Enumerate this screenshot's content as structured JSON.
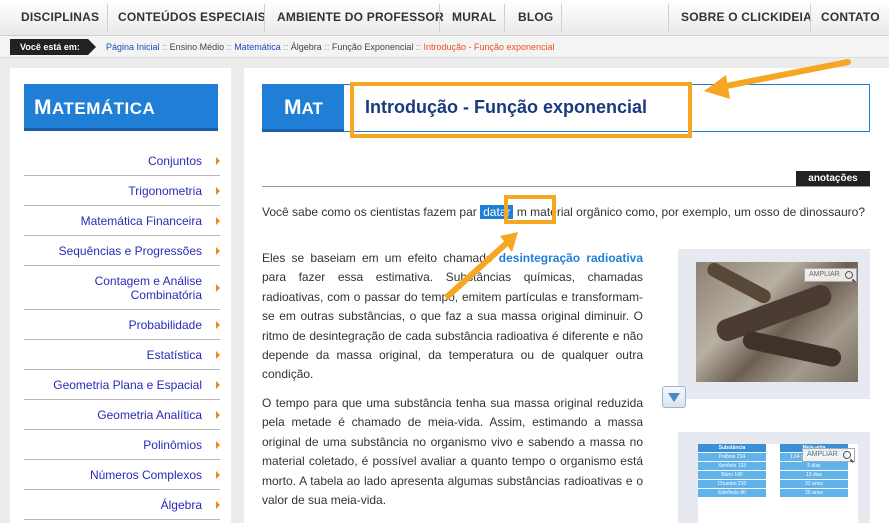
{
  "topnav": {
    "left": [
      "DISCIPLINAS",
      "CONTEÚDOS ESPECIAIS",
      "AMBIENTE DO PROFESSOR",
      "MURAL",
      "BLOG"
    ],
    "right": [
      "SOBRE O CLICKIDEIA",
      "CONTATO"
    ]
  },
  "breadcrumb": {
    "label": "Você está em:",
    "items": [
      "Página Inicial",
      "Ensino Médio",
      "Matemática",
      "Álgebra",
      "Função Exponencial"
    ],
    "separator": "::",
    "current": "Introdução - Função exponencial"
  },
  "sidebar": {
    "title_first": "M",
    "title_rest": "ATEMÁTICA",
    "items": [
      "Conjuntos",
      "Trigonometria",
      "Matemática Financeira",
      "Sequências e Progressões",
      "Contagem e Análise Combinatória",
      "Probabilidade",
      "Estatística",
      "Geometria Plana e Espacial",
      "Geometria Analítica",
      "Polinômios",
      "Números Complexos",
      "Álgebra"
    ]
  },
  "content": {
    "mat_first": "M",
    "mat_rest": "AT",
    "title": "Introdução - Função exponencial",
    "annotations_tab": "anotações",
    "p1_before": "Você sabe como os cientistas fazem par",
    "p1_word": "datar",
    "p1_after": "m material orgânico como, por exemplo, um osso de dinossauro?",
    "p2_before": "Eles se baseiam em um efeito ",
    "p2_gap": "chamado ",
    "p2_link": "desintegração radioativa",
    "p2_after": " para fazer essa estimativa. Substâncias químicas, chamadas radioativas, com o passar do tempo, emitem partículas e transformam-se em outras substâncias, o que faz a sua massa original diminuir. O ritmo de desintegração de cada substância radioativa é diferente e não depende da massa original, da temperatura ou de qualquer outra condição.",
    "p3": "O tempo para que uma substância tenha sua massa original reduzida pela metade é chamado de meia-vida. Assim, estimando a massa original de uma substância no organismo vivo e sabendo a massa no material coletado, é possível avaliar a quanto tempo o organismo está morto. A tabela ao lado apresenta algumas substâncias radioativas e o valor de sua meia-vida.",
    "ampliar": "AMPLIAR",
    "table": {
      "headers": [
        "Substância",
        "Meia-vida"
      ],
      "rows": [
        [
          "Polônio 214",
          "1,64 x 10-4 segundos"
        ],
        [
          "Xenônio 133",
          "5 dias"
        ],
        [
          "Bário 140",
          "13 dias"
        ],
        [
          "Chumbo 210",
          "22 anos"
        ],
        [
          "Estrôncio 90",
          "25 anos"
        ]
      ]
    }
  },
  "colors": {
    "accent_blue": "#1f7fd6",
    "highlight_orange": "#f5a623",
    "title_navy": "#183a7e",
    "breadcrumb_current": "#e8541e"
  }
}
